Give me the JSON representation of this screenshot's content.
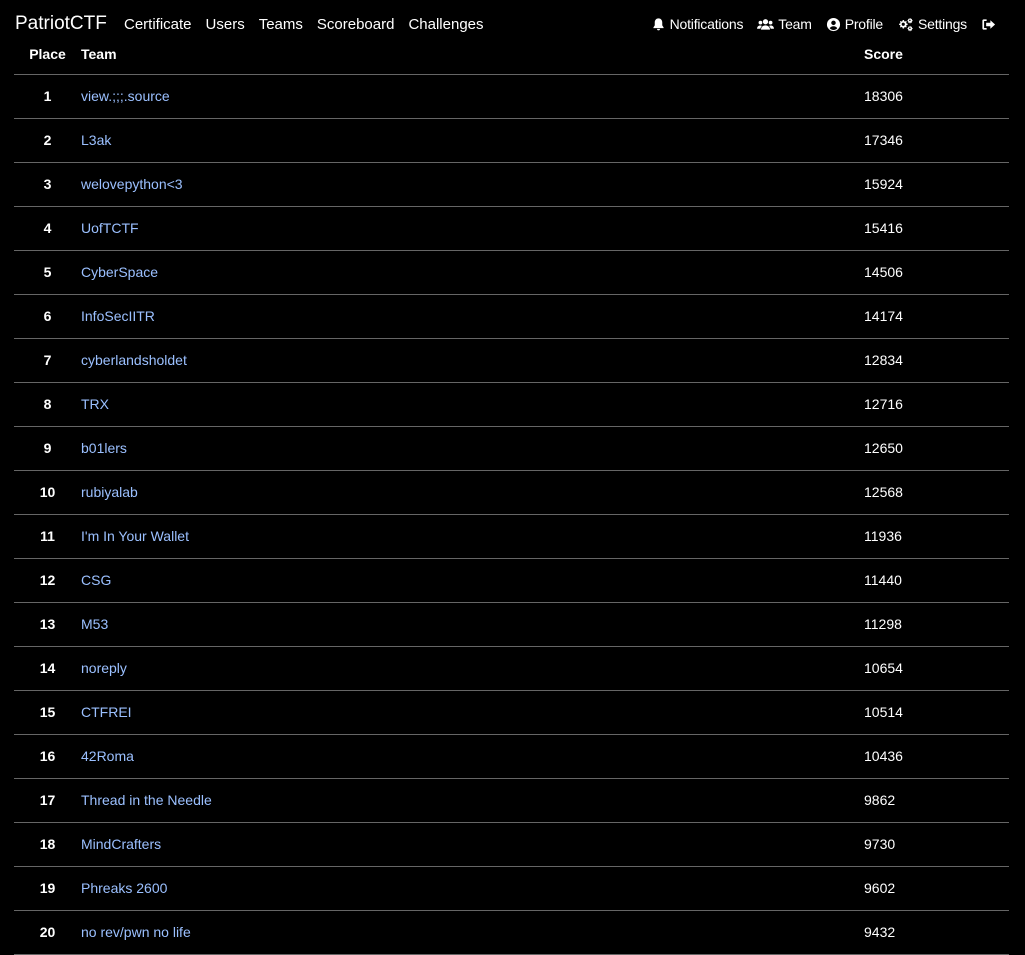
{
  "nav": {
    "brand": "PatriotCTF",
    "links": [
      "Certificate",
      "Users",
      "Teams",
      "Scoreboard",
      "Challenges"
    ],
    "right": [
      {
        "icon": "bell-icon",
        "label": "Notifications"
      },
      {
        "icon": "users-icon",
        "label": "Team"
      },
      {
        "icon": "user-circle-icon",
        "label": "Profile"
      },
      {
        "icon": "cogs-icon",
        "label": "Settings"
      },
      {
        "icon": "sign-out-icon",
        "label": ""
      }
    ]
  },
  "table": {
    "headers": {
      "place": "Place",
      "team": "Team",
      "score": "Score"
    },
    "rows": [
      {
        "place": "1",
        "team": "view.;;;.source",
        "score": "18306"
      },
      {
        "place": "2",
        "team": "L3ak",
        "score": "17346"
      },
      {
        "place": "3",
        "team": "welovepython<3",
        "score": "15924"
      },
      {
        "place": "4",
        "team": "UofTCTF",
        "score": "15416"
      },
      {
        "place": "5",
        "team": "CyberSpace",
        "score": "14506"
      },
      {
        "place": "6",
        "team": "InfoSecIITR",
        "score": "14174"
      },
      {
        "place": "7",
        "team": "cyberlandsholdet",
        "score": "12834"
      },
      {
        "place": "8",
        "team": "TRX",
        "score": "12716"
      },
      {
        "place": "9",
        "team": "b01lers",
        "score": "12650"
      },
      {
        "place": "10",
        "team": "rubiyalab",
        "score": "12568"
      },
      {
        "place": "11",
        "team": "I'm In Your Wallet",
        "score": "11936"
      },
      {
        "place": "12",
        "team": "CSG",
        "score": "11440"
      },
      {
        "place": "13",
        "team": "M53",
        "score": "11298"
      },
      {
        "place": "14",
        "team": "noreply",
        "score": "10654"
      },
      {
        "place": "15",
        "team": "CTFREI",
        "score": "10514"
      },
      {
        "place": "16",
        "team": "42Roma",
        "score": "10436"
      },
      {
        "place": "17",
        "team": "Thread in the Needle",
        "score": "9862"
      },
      {
        "place": "18",
        "team": "MindCrafters",
        "score": "9730"
      },
      {
        "place": "19",
        "team": "Phreaks 2600",
        "score": "9602"
      },
      {
        "place": "20",
        "team": "no rev/pwn no life",
        "score": "9432"
      }
    ]
  },
  "colors": {
    "background": "#000000",
    "link": "#9bc0ff",
    "text": "#ffffff",
    "divider": "#666666"
  }
}
